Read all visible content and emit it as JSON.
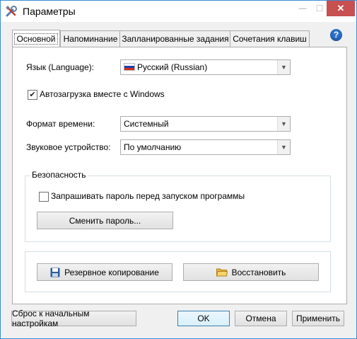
{
  "window": {
    "title": "Параметры",
    "close_glyph": "✕",
    "minimize_glyph": "—",
    "maximize_glyph": "☐"
  },
  "tabs": [
    {
      "label": "Основной",
      "active": true
    },
    {
      "label": "Напоминание",
      "active": false
    },
    {
      "label": "Запланированные задания",
      "active": false
    },
    {
      "label": "Сочетания клавиш",
      "active": false
    }
  ],
  "help_glyph": "?",
  "general": {
    "language_label": "Язык (Language):",
    "language_value": "Русский (Russian)",
    "autostart_label": "Автозагрузка вместе с Windows",
    "autostart_checked": true,
    "time_format_label": "Формат времени:",
    "time_format_value": "Системный",
    "sound_device_label": "Звуковое устройство:",
    "sound_device_value": "По умолчанию"
  },
  "security": {
    "group_title": "Безопасность",
    "ask_password_label": "Запрашивать пароль перед запуском программы",
    "ask_password_checked": false,
    "change_password_button": "Сменить пароль..."
  },
  "backup": {
    "backup_button": "Резервное копирование",
    "restore_button": "Восстановить"
  },
  "footer": {
    "reset_button": "Сброс к начальным настройкам",
    "ok_button": "OK",
    "cancel_button": "Отмена",
    "apply_button": "Применить"
  }
}
